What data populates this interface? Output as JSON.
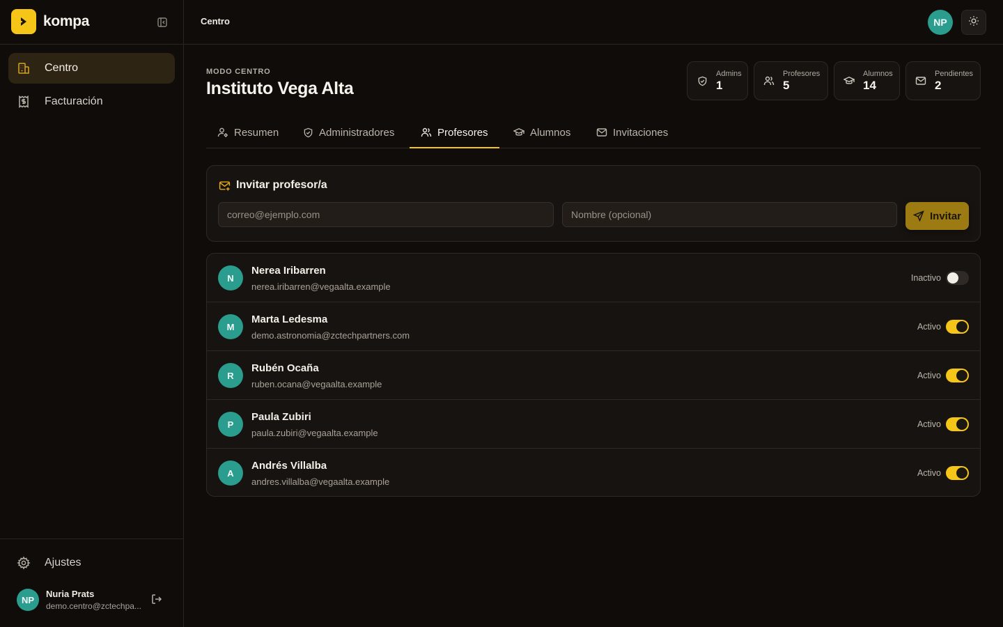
{
  "brand": {
    "name": "kompa",
    "color": "#f5c518"
  },
  "sidebar": {
    "items": [
      {
        "label": "Centro",
        "icon": "building-icon",
        "active": true
      },
      {
        "label": "Facturación",
        "icon": "receipt-icon",
        "active": false
      }
    ],
    "settings_label": "Ajustes",
    "user": {
      "initials": "NP",
      "name": "Nuria Prats",
      "email": "demo.centro@zctechpa..."
    }
  },
  "topbar": {
    "title": "Centro",
    "avatar_initials": "NP"
  },
  "header": {
    "eyebrow": "MODO CENTRO",
    "title": "Instituto Vega Alta"
  },
  "stats": [
    {
      "label": "Admins",
      "value": "1",
      "icon": "shield-icon"
    },
    {
      "label": "Profesores",
      "value": "5",
      "icon": "users-icon"
    },
    {
      "label": "Alumnos",
      "value": "14",
      "icon": "graduation-cap-icon"
    },
    {
      "label": "Pendientes",
      "value": "2",
      "icon": "mail-icon"
    }
  ],
  "tabs": [
    {
      "label": "Resumen",
      "icon": "user-cog-icon",
      "active": false
    },
    {
      "label": "Administradores",
      "icon": "shield-icon",
      "active": false
    },
    {
      "label": "Profesores",
      "icon": "users-icon",
      "active": true
    },
    {
      "label": "Alumnos",
      "icon": "graduation-cap-icon",
      "active": false
    },
    {
      "label": "Invitaciones",
      "icon": "mail-icon",
      "active": false
    }
  ],
  "invite": {
    "title": "Invitar profesor/a",
    "email_placeholder": "correo@ejemplo.com",
    "name_placeholder": "Nombre (opcional)",
    "button_label": "Invitar"
  },
  "teachers": [
    {
      "initial": "N",
      "name": "Nerea Iribarren",
      "email": "nerea.iribarren@vegaalta.example",
      "status": "Inactivo",
      "active": false
    },
    {
      "initial": "M",
      "name": "Marta Ledesma",
      "email": "demo.astronomia@zctechpartners.com",
      "status": "Activo",
      "active": true
    },
    {
      "initial": "R",
      "name": "Rubén Ocaña",
      "email": "ruben.ocana@vegaalta.example",
      "status": "Activo",
      "active": true
    },
    {
      "initial": "P",
      "name": "Paula Zubiri",
      "email": "paula.zubiri@vegaalta.example",
      "status": "Activo",
      "active": true
    },
    {
      "initial": "A",
      "name": "Andrés Villalba",
      "email": "andres.villalba@vegaalta.example",
      "status": "Activo",
      "active": true
    }
  ],
  "colors": {
    "accent": "#f5c518",
    "avatar": "#2a9d8f",
    "background": "#0f0c0a",
    "surface": "#171310"
  }
}
